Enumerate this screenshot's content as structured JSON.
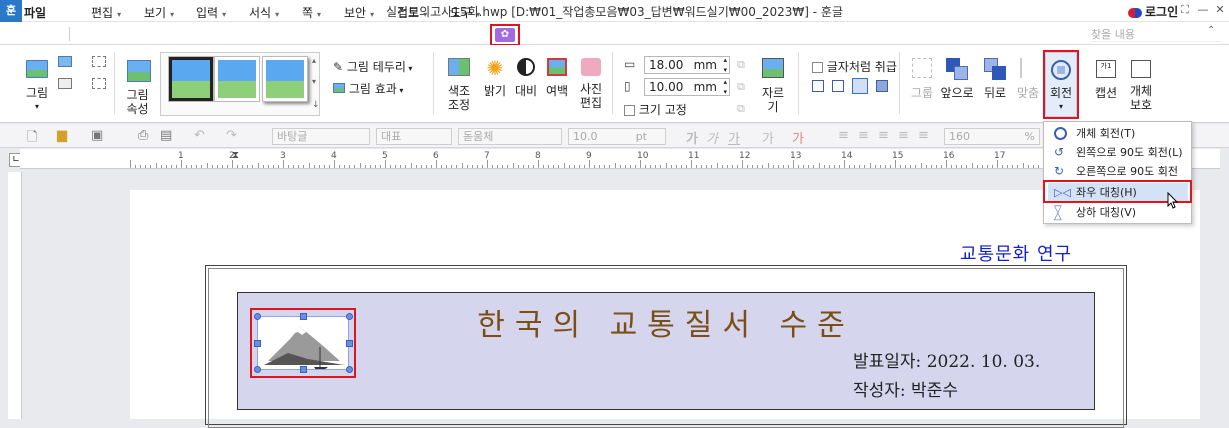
{
  "window": {
    "logo": "훈",
    "title": "실전모의고사15회.hwp [D:₩01_작업총모음₩03_답변₩워드실기₩00_2023₩] - 훈글",
    "login": "로그인"
  },
  "menubar": {
    "file": "파일",
    "items": [
      "편집",
      "보기",
      "입력",
      "서식",
      "쪽",
      "보안",
      "검토",
      "도구"
    ],
    "search_placeholder": "찾을 내용"
  },
  "ribbon": {
    "picture": "그림",
    "picture_props": [
      "그림",
      "속성"
    ],
    "border": "그림 테두리",
    "effect": "그림 효과",
    "color_adjust": [
      "색조",
      "조정"
    ],
    "brightness": "밝기",
    "contrast": "대비",
    "margin": "여백",
    "photo_edit": [
      "사진",
      "편집"
    ],
    "width": "18.00",
    "height": "10.00",
    "unit": "mm",
    "fix_size": "크기 고정",
    "crop": "자르기",
    "treat_as_char": "글자처럼 취급",
    "group": "그룹",
    "to_front": "앞으로",
    "to_back": "뒤로",
    "align": "맞춤",
    "rotate": "회전",
    "caption": "캡션",
    "protect": [
      "개체",
      "보호"
    ]
  },
  "toolbar2": {
    "style": "바탕글",
    "lang": "대표",
    "font": "돋움체",
    "size": "10.0",
    "size_unit": "pt",
    "zoom": "160",
    "zoom_unit": "%"
  },
  "ruler": {
    "numbers": [
      "1",
      "2",
      "3",
      "4",
      "5",
      "6",
      "7",
      "8",
      "9",
      "10",
      "11",
      "12",
      "13",
      "14",
      "15",
      "16",
      "17"
    ]
  },
  "document": {
    "header_right": "교통문화 연구",
    "title": "한국의 교통질서 수준",
    "date": "발표일자: 2022. 10. 03.",
    "author": "작성자: 박준수"
  },
  "rotate_menu": [
    {
      "label": "개체 회전(T)",
      "icon": "rotate-object-icon"
    },
    {
      "label": "왼쪽으로 90도 회전(L)",
      "icon": "rotate-left-icon"
    },
    {
      "label": "오른쪽으로 90도 회전(R)",
      "icon": "rotate-right-icon"
    },
    {
      "label": "좌우 대칭(H)",
      "icon": "flip-horizontal-icon"
    },
    {
      "label": "상하 대칭(V)",
      "icon": "flip-vertical-icon"
    }
  ],
  "colors": {
    "highlight": "#e0141e",
    "title_box_bg": "#d5d5ee",
    "title_text": "#7a4f16",
    "header_text": "#1622c8"
  }
}
